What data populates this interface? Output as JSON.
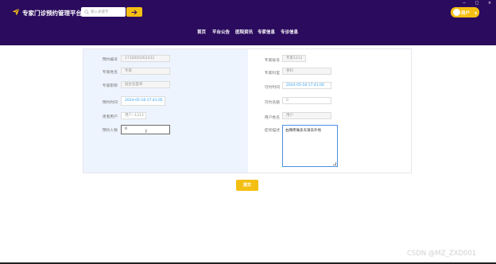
{
  "header": {
    "title": "专家门诊预约管理平台",
    "search_placeholder": "输入关键字",
    "user_label": "用户"
  },
  "window_controls": [
    "−",
    "□",
    "×"
  ],
  "nav": [
    "首页",
    "平台公告",
    "医院资讯",
    "专家信息",
    "专诊信息"
  ],
  "form": {
    "left": [
      {
        "label": "预约编号",
        "value": "1716005062432"
      },
      {
        "label": "专家姓名",
        "value": "专家"
      },
      {
        "label": "专家职称",
        "value": "副主任医师"
      },
      {
        "label": "预约时间",
        "value": "2024-05-18 17:41:05"
      },
      {
        "label": "患者用户",
        "value": "用户--1213"
      },
      {
        "label": "预约人数",
        "value": "0"
      }
    ],
    "right": [
      {
        "label": "专家账号",
        "value": "专家1212"
      },
      {
        "label": "专家科室",
        "value": "骨科"
      },
      {
        "label": "可约时间",
        "value": "2024-05-18 17:41:00"
      },
      {
        "label": "可约名额",
        "value": "0"
      },
      {
        "label": "用户姓名",
        "value": "用户"
      },
      {
        "label": "症状描述",
        "value": "右踝疼痛多天请去外地"
      }
    ]
  },
  "submit_label": "提交",
  "watermark": "CSDN @MZ_ZXD001",
  "colors": {
    "header_bg": "#2b0b5e",
    "accent": "#f4bf13",
    "left_panel_bg": "#eef4fd"
  }
}
